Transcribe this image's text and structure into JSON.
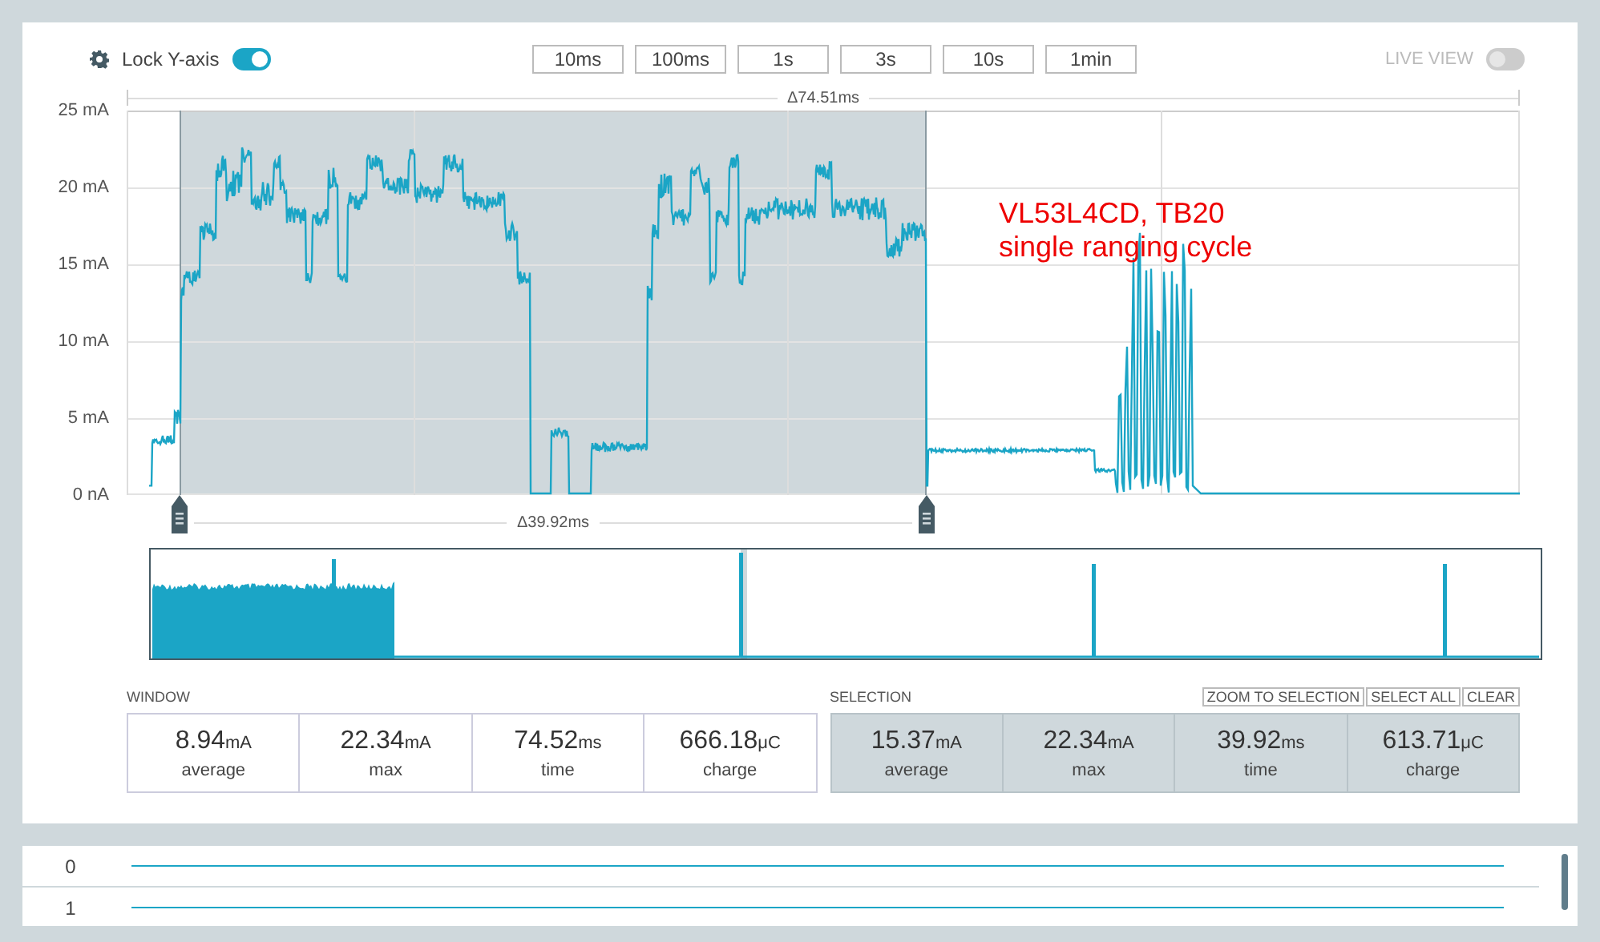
{
  "toolbar": {
    "lock_y_axis": {
      "label": "Lock Y-axis",
      "on": true
    },
    "time_buttons": [
      "10ms",
      "100ms",
      "1s",
      "3s",
      "10s",
      "1min"
    ],
    "live_view": {
      "label": "LIVE VIEW",
      "on": false
    }
  },
  "chart": {
    "window_delta": "Δ74.51ms",
    "y_ticks": [
      "25 mA",
      "20 mA",
      "15 mA",
      "10 mA",
      "5 mA",
      "0 nA"
    ],
    "selection_delta": "Δ39.92ms",
    "annotation": [
      "VL53L4CD, TB20",
      "single ranging cycle"
    ]
  },
  "window": {
    "title": "WINDOW",
    "stats": [
      {
        "value": "8.94",
        "unit": "mA",
        "label": "average"
      },
      {
        "value": "22.34",
        "unit": "mA",
        "label": "max"
      },
      {
        "value": "74.52",
        "unit": "ms",
        "label": "time"
      },
      {
        "value": "666.18",
        "unit": "μC",
        "label": "charge"
      }
    ]
  },
  "selection": {
    "title": "SELECTION",
    "actions": [
      "ZOOM TO SELECTION",
      "SELECT ALL",
      "CLEAR"
    ],
    "stats": [
      {
        "value": "15.37",
        "unit": "mA",
        "label": "average"
      },
      {
        "value": "22.34",
        "unit": "mA",
        "label": "max"
      },
      {
        "value": "39.92",
        "unit": "ms",
        "label": "time"
      },
      {
        "value": "613.71",
        "unit": "μC",
        "label": "charge"
      }
    ]
  },
  "digital_channels": [
    {
      "label": "0"
    },
    {
      "label": "1"
    }
  ]
}
